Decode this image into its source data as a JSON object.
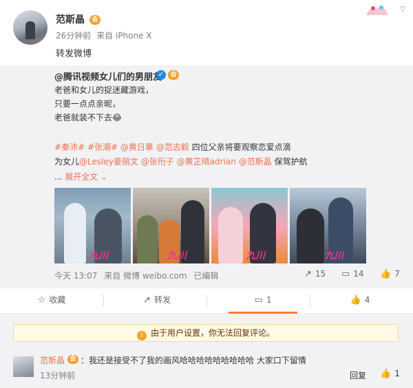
{
  "post": {
    "author": "范斯晶",
    "badge": "会",
    "time": "26分钟前",
    "source": "来自 iPhone X",
    "text": "转发微博"
  },
  "repost": {
    "author": "@腾讯视频女儿们的男朋友",
    "lines": [
      "老爸和女儿的捉迷藏游戏，",
      "只要一点点亲昵，",
      "老爸就装不下去😂"
    ],
    "tags_line1": {
      "tag1": "#秦沛#",
      "tag2": "#张潮#",
      "m1": "@黄日華",
      "m2": "@范志毅",
      "rest": "四位父亲将要观察恋爱点滴"
    },
    "tags_line2": {
      "prefix": "为女儿",
      "m1": "@Lesley姜丽文",
      "m2": "@张衎子",
      "m3": "@黄芷晴adrian",
      "m4": "@范斯晶",
      "rest": "保驾护航"
    },
    "expand": "展开全文",
    "ellipsis": "...",
    "thumb_logo": "九川",
    "footer": {
      "time": "今天 13:07",
      "source": "来自 微博 weibo.com",
      "edited": "已编辑"
    },
    "stats": {
      "forward": "15",
      "comment": "14",
      "like": "7"
    }
  },
  "actions": {
    "collect": "收藏",
    "forward": "转发",
    "comment": "1",
    "like": "4"
  },
  "notice": "由于用户设置，你无法回复评论。",
  "comment": {
    "author": "范斯晶",
    "badge": "会",
    "text": "：我还是接受不了我的画风哈哈哈哈哈哈哈哈哈 大家口下留情",
    "time": "13分钟前",
    "reply": "回复",
    "likes": "1"
  },
  "colors": {
    "accent": "#eb7350",
    "orange_bar": "#fa7d3c",
    "verified": "#1f8be6"
  }
}
